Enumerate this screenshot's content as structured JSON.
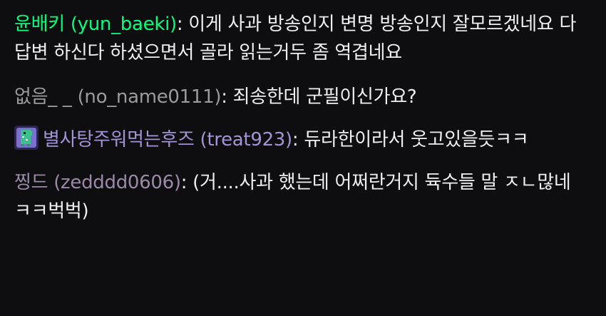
{
  "colors": {
    "background": "#0e0e10",
    "text": "#efeff1",
    "green_name": "#00ff7f",
    "gray_name": "#9b9b9b",
    "purple_name": "#a394d6",
    "pink_name": "#9a8aa8"
  },
  "messages": [
    {
      "user": "윤배키 (yun_baeki)",
      "separator": ":",
      "text": " 이게 사과 방송인지 변명 방송인지 잘모르겠네요 다 답변 하신다 하셨으면서 골라 읽는거두 좀 역겹네요",
      "name_color": "#00ff7f"
    },
    {
      "user": "없음_ _ (no_name0111)",
      "separator": ":",
      "text": " 죄송한데 군필이신가요?",
      "name_color": "#9b9b9b"
    },
    {
      "badge_icon": "dino-badge-icon",
      "user": "별사탕주워먹는후즈 (treat923)",
      "separator": ":",
      "text": " 듀라한이라서 웃고있을듯ㅋㅋ",
      "name_color": "#a394d6"
    },
    {
      "user": "찡드 (zedddd0606)",
      "separator": ":",
      "text": " (거....사과 했는데 어쩌란거지 듁수들 말 ㅈㄴ많네 ㅋㅋ벅벅)",
      "name_color": "#9a8aa8"
    }
  ]
}
